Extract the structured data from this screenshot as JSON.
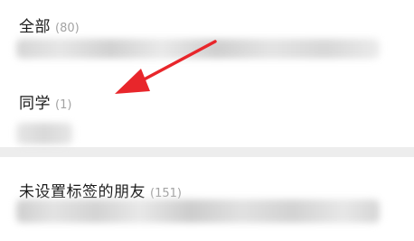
{
  "groups": [
    {
      "name": "全部",
      "count": "(80)"
    },
    {
      "name": "同学",
      "count": "(1)"
    },
    {
      "name": "未设置标签的朋友",
      "count": "(151)"
    }
  ],
  "annotation": {
    "arrow_color": "#e8262b",
    "icon": "red-arrow-icon"
  },
  "colors": {
    "background": "#ededed",
    "card": "#ffffff",
    "title_text": "#191919",
    "count_text": "#a3a3a3"
  }
}
